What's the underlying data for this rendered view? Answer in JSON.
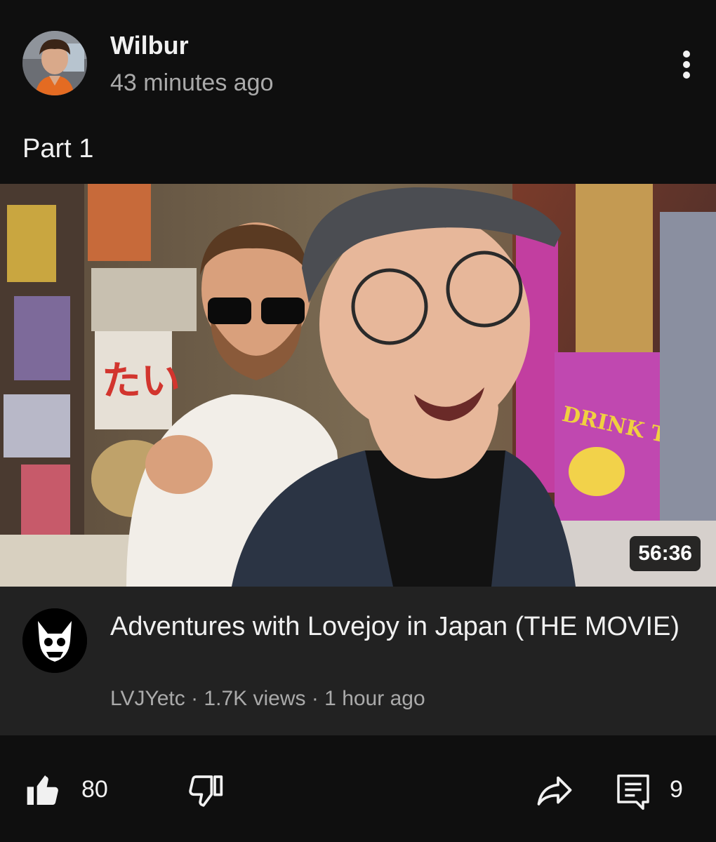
{
  "post": {
    "author": "Wilbur",
    "time": "43 minutes ago",
    "text": "Part 1",
    "avatar_icon": "user-avatar-photo",
    "menu_icon": "more-vertical-icon"
  },
  "video": {
    "duration": "56:36",
    "title": "Adventures with Lovejoy in Japan (THE MOVIE)",
    "channel": "LVJYetc",
    "views": "1.7K views",
    "age": "1 hour ago",
    "channel_avatar_icon": "fox-skull-logo"
  },
  "actions": {
    "like_count": "80",
    "comment_count": "9",
    "like_icon": "thumbs-up-filled-icon",
    "dislike_icon": "thumbs-down-icon",
    "share_icon": "share-icon",
    "comment_icon": "comment-icon"
  },
  "colors": {
    "background": "#0f0f0f",
    "card": "#222222",
    "text_primary": "#f1f1f1",
    "text_secondary": "#aaaaaa"
  }
}
